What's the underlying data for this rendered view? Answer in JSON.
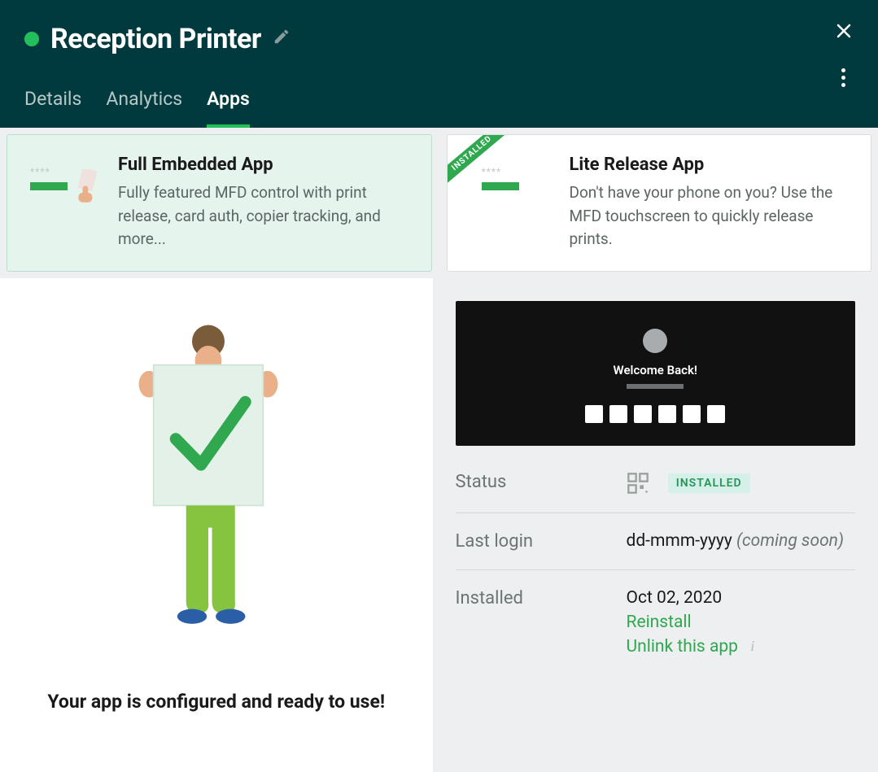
{
  "header": {
    "title": "Reception Printer"
  },
  "tabs": [
    {
      "label": "Details",
      "active": false
    },
    {
      "label": "Analytics",
      "active": false
    },
    {
      "label": "Apps",
      "active": true
    }
  ],
  "apps": {
    "full": {
      "title": "Full Embedded App",
      "desc": "Fully featured MFD control with print release, card auth, copier tracking, and more..."
    },
    "lite": {
      "ribbon": "INSTALLED",
      "title": "Lite Release App",
      "desc": "Don't have your phone on you? Use the MFD touchscreen to quickly release prints."
    }
  },
  "left": {
    "ready": "Your app is configured and ready to use!"
  },
  "preview": {
    "welcome": "Welcome Back!"
  },
  "info": {
    "status_label": "Status",
    "status_badge": "INSTALLED",
    "lastlogin_label": "Last login",
    "lastlogin_value": "dd-mmm-yyyy",
    "lastlogin_note": "(coming soon)",
    "installed_label": "Installed",
    "installed_date": "Oct 02, 2020",
    "reinstall": "Reinstall",
    "unlink": "Unlink this app"
  }
}
